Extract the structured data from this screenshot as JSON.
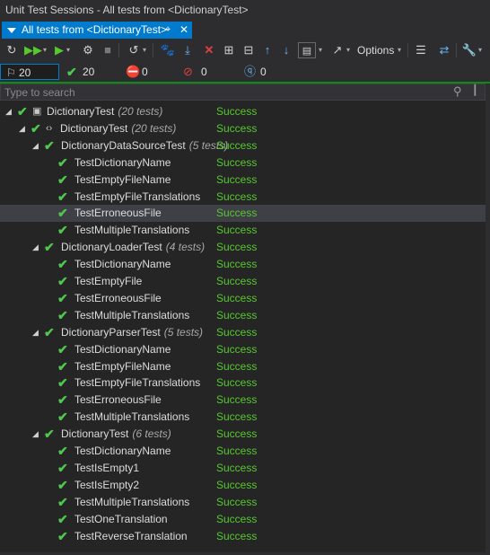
{
  "window": {
    "title": "Unit Test Sessions - All tests from <DictionaryTest>"
  },
  "tab": {
    "label": "All tests from <DictionaryTest>",
    "pin": "⌖",
    "close": "✕"
  },
  "toolbar": {
    "options_label": "Options"
  },
  "counts": {
    "total": "20",
    "passed": "20",
    "failed": "0",
    "ignored": "0",
    "unknown": "0"
  },
  "search": {
    "placeholder": "Type to search"
  },
  "colors": {
    "accent": "#007acc",
    "success": "#57c72f",
    "check": "#4ec94e",
    "selected": "#3f3f46"
  },
  "tree": {
    "rows": [
      {
        "name": "DictionaryTest",
        "count": "(20 tests)",
        "status": "Success",
        "icon": "project-icon"
      },
      {
        "name": "DictionaryTest",
        "count": "(20 tests)",
        "status": "Success",
        "icon": "namespace-icon"
      },
      {
        "name": "DictionaryDataSourceTest",
        "count": "(5 tests)",
        "status": "Success"
      },
      {
        "name": "TestDictionaryName",
        "status": "Success"
      },
      {
        "name": "TestEmptyFileName",
        "status": "Success"
      },
      {
        "name": "TestEmptyFileTranslations",
        "status": "Success"
      },
      {
        "name": "TestErroneousFile",
        "status": "Success"
      },
      {
        "name": "TestMultipleTranslations",
        "status": "Success"
      },
      {
        "name": "DictionaryLoaderTest",
        "count": "(4 tests)",
        "status": "Success"
      },
      {
        "name": "TestDictionaryName",
        "status": "Success"
      },
      {
        "name": "TestEmptyFile",
        "status": "Success"
      },
      {
        "name": "TestErroneousFile",
        "status": "Success"
      },
      {
        "name": "TestMultipleTranslations",
        "status": "Success"
      },
      {
        "name": "DictionaryParserTest",
        "count": "(5 tests)",
        "status": "Success"
      },
      {
        "name": "TestDictionaryName",
        "status": "Success"
      },
      {
        "name": "TestEmptyFileName",
        "status": "Success"
      },
      {
        "name": "TestEmptyFileTranslations",
        "status": "Success"
      },
      {
        "name": "TestErroneousFile",
        "status": "Success"
      },
      {
        "name": "TestMultipleTranslations",
        "status": "Success"
      },
      {
        "name": "DictionaryTest",
        "count": "(6 tests)",
        "status": "Success"
      },
      {
        "name": "TestDictionaryName",
        "status": "Success"
      },
      {
        "name": "TestIsEmpty1",
        "status": "Success"
      },
      {
        "name": "TestIsEmpty2",
        "status": "Success"
      },
      {
        "name": "TestMultipleTranslations",
        "status": "Success"
      },
      {
        "name": "TestOneTranslation",
        "status": "Success"
      },
      {
        "name": "TestReverseTranslation",
        "status": "Success"
      }
    ]
  }
}
